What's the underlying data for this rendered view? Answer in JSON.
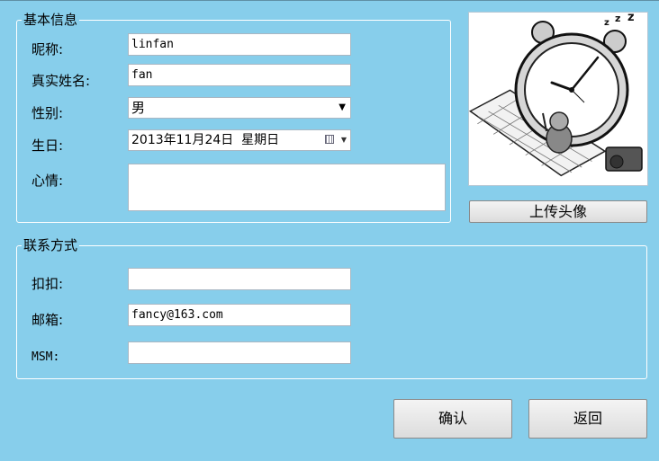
{
  "basic_info": {
    "legend": "基本信息",
    "nickname_label": "昵称:",
    "nickname_value": "linfan",
    "realname_label": "真实姓名:",
    "realname_value": "fan",
    "gender_label": "性别:",
    "gender_value": "男",
    "birthday_label": "生日:",
    "birthday_value": "2013年11月24日  星期日",
    "mood_label": "心情:",
    "mood_value": ""
  },
  "avatar": {
    "icon": "alarm-clock-cartoon",
    "upload_label": "上传头像"
  },
  "contact": {
    "legend": "联系方式",
    "qq_label": "扣扣:",
    "qq_value": "",
    "email_label": "邮箱:",
    "email_value": "fancy@163.com",
    "msm_label": "MSM:",
    "msm_value": ""
  },
  "actions": {
    "confirm_label": "确认",
    "back_label": "返回"
  }
}
